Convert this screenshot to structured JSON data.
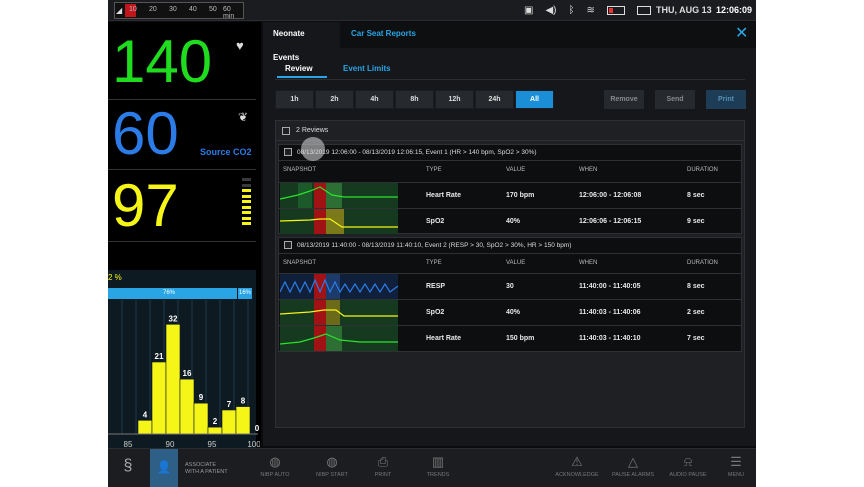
{
  "status": {
    "timescale_labels": [
      "10",
      "20",
      "30",
      "40",
      "50",
      "60 min"
    ],
    "date": "THU, AUG 13",
    "time": "12:06:09"
  },
  "vitals": {
    "hr": "140",
    "co2": "60",
    "co2_source": "Source CO2",
    "spo2": "97"
  },
  "histogram": {
    "pct_label": "2 %",
    "top_left_label": "76%",
    "top_right_label": "16%",
    "bar_values": [
      4,
      21,
      32,
      16,
      9,
      2,
      7,
      8,
      0
    ],
    "x_ticks": [
      "85",
      "90",
      "95",
      "100"
    ]
  },
  "panel": {
    "tab_neonate": "Neonate Events",
    "tab_carseat": "Car Seat Reports",
    "sub_review": "Review",
    "sub_limits": "Event Limits",
    "time_buttons": [
      "1h",
      "2h",
      "4h",
      "8h",
      "12h",
      "24h",
      "All"
    ],
    "active_time": "All",
    "remove": "Remove",
    "send": "Send",
    "print": "Print",
    "reviews_count": "2 Reviews",
    "columns": {
      "snapshot": "SNAPSHOT",
      "type": "TYPE",
      "value": "VALUE",
      "when": "WHEN",
      "duration": "DURATION"
    },
    "events": [
      {
        "title": "08/13/2019 12:06:00 - 08/13/2019 12:06:15, Event 1 (HR > 140 bpm, SpO2 > 30%)",
        "rows": [
          {
            "type": "Heart Rate",
            "value": "170 bpm",
            "when": "12:06:00 - 12:06:08",
            "duration": "8 sec"
          },
          {
            "type": "SpO2",
            "value": "40%",
            "when": "12:06:06 - 12:06:15",
            "duration": "9 sec"
          }
        ]
      },
      {
        "title": "08/13/2019 11:40:00 - 08/13/2019 11:40:10, Event 2 (RESP > 30, SpO2 > 30%, HR > 150 bpm)",
        "rows": [
          {
            "type": "RESP",
            "value": "30",
            "when": "11:40:00 - 11:40:05",
            "duration": "8 sec"
          },
          {
            "type": "SpO2",
            "value": "40%",
            "when": "11:40:03 - 11:40:06",
            "duration": "2 sec"
          },
          {
            "type": "Heart Rate",
            "value": "150 bpm",
            "when": "11:40:03 - 11:40:10",
            "duration": "7 sec"
          }
        ]
      }
    ]
  },
  "bottom": {
    "associate_line1": "ASSOCIATE",
    "associate_line2": "WITH A PATIENT",
    "nibp_auto": "NIBP AUTO",
    "nibp_start": "NIBP START",
    "print": "PRINT",
    "trends": "TRENDS",
    "acknowledge": "ACKNOWLEDGE",
    "pause_alarms": "PAUSE ALARMS",
    "audio_pause": "AUDIO PAUSE",
    "menu": "MENU"
  },
  "colors": {
    "hr": "#1fdc1f",
    "co2": "#2b7ce9",
    "spo2": "#f5f517",
    "accent": "#29a5e5"
  }
}
